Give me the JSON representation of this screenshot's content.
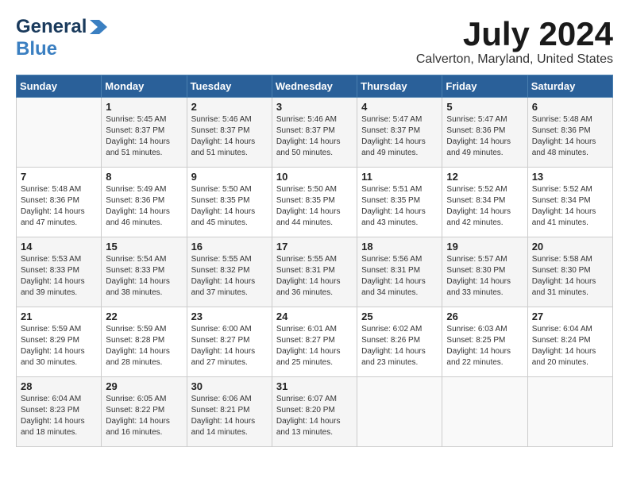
{
  "header": {
    "logo_line1": "General",
    "logo_line2": "Blue",
    "month": "July 2024",
    "location": "Calverton, Maryland, United States"
  },
  "days_of_week": [
    "Sunday",
    "Monday",
    "Tuesday",
    "Wednesday",
    "Thursday",
    "Friday",
    "Saturday"
  ],
  "weeks": [
    [
      {
        "day": "",
        "content": ""
      },
      {
        "day": "1",
        "content": "Sunrise: 5:45 AM\nSunset: 8:37 PM\nDaylight: 14 hours\nand 51 minutes."
      },
      {
        "day": "2",
        "content": "Sunrise: 5:46 AM\nSunset: 8:37 PM\nDaylight: 14 hours\nand 51 minutes."
      },
      {
        "day": "3",
        "content": "Sunrise: 5:46 AM\nSunset: 8:37 PM\nDaylight: 14 hours\nand 50 minutes."
      },
      {
        "day": "4",
        "content": "Sunrise: 5:47 AM\nSunset: 8:37 PM\nDaylight: 14 hours\nand 49 minutes."
      },
      {
        "day": "5",
        "content": "Sunrise: 5:47 AM\nSunset: 8:36 PM\nDaylight: 14 hours\nand 49 minutes."
      },
      {
        "day": "6",
        "content": "Sunrise: 5:48 AM\nSunset: 8:36 PM\nDaylight: 14 hours\nand 48 minutes."
      }
    ],
    [
      {
        "day": "7",
        "content": "Sunrise: 5:48 AM\nSunset: 8:36 PM\nDaylight: 14 hours\nand 47 minutes."
      },
      {
        "day": "8",
        "content": "Sunrise: 5:49 AM\nSunset: 8:36 PM\nDaylight: 14 hours\nand 46 minutes."
      },
      {
        "day": "9",
        "content": "Sunrise: 5:50 AM\nSunset: 8:35 PM\nDaylight: 14 hours\nand 45 minutes."
      },
      {
        "day": "10",
        "content": "Sunrise: 5:50 AM\nSunset: 8:35 PM\nDaylight: 14 hours\nand 44 minutes."
      },
      {
        "day": "11",
        "content": "Sunrise: 5:51 AM\nSunset: 8:35 PM\nDaylight: 14 hours\nand 43 minutes."
      },
      {
        "day": "12",
        "content": "Sunrise: 5:52 AM\nSunset: 8:34 PM\nDaylight: 14 hours\nand 42 minutes."
      },
      {
        "day": "13",
        "content": "Sunrise: 5:52 AM\nSunset: 8:34 PM\nDaylight: 14 hours\nand 41 minutes."
      }
    ],
    [
      {
        "day": "14",
        "content": "Sunrise: 5:53 AM\nSunset: 8:33 PM\nDaylight: 14 hours\nand 39 minutes."
      },
      {
        "day": "15",
        "content": "Sunrise: 5:54 AM\nSunset: 8:33 PM\nDaylight: 14 hours\nand 38 minutes."
      },
      {
        "day": "16",
        "content": "Sunrise: 5:55 AM\nSunset: 8:32 PM\nDaylight: 14 hours\nand 37 minutes."
      },
      {
        "day": "17",
        "content": "Sunrise: 5:55 AM\nSunset: 8:31 PM\nDaylight: 14 hours\nand 36 minutes."
      },
      {
        "day": "18",
        "content": "Sunrise: 5:56 AM\nSunset: 8:31 PM\nDaylight: 14 hours\nand 34 minutes."
      },
      {
        "day": "19",
        "content": "Sunrise: 5:57 AM\nSunset: 8:30 PM\nDaylight: 14 hours\nand 33 minutes."
      },
      {
        "day": "20",
        "content": "Sunrise: 5:58 AM\nSunset: 8:30 PM\nDaylight: 14 hours\nand 31 minutes."
      }
    ],
    [
      {
        "day": "21",
        "content": "Sunrise: 5:59 AM\nSunset: 8:29 PM\nDaylight: 14 hours\nand 30 minutes."
      },
      {
        "day": "22",
        "content": "Sunrise: 5:59 AM\nSunset: 8:28 PM\nDaylight: 14 hours\nand 28 minutes."
      },
      {
        "day": "23",
        "content": "Sunrise: 6:00 AM\nSunset: 8:27 PM\nDaylight: 14 hours\nand 27 minutes."
      },
      {
        "day": "24",
        "content": "Sunrise: 6:01 AM\nSunset: 8:27 PM\nDaylight: 14 hours\nand 25 minutes."
      },
      {
        "day": "25",
        "content": "Sunrise: 6:02 AM\nSunset: 8:26 PM\nDaylight: 14 hours\nand 23 minutes."
      },
      {
        "day": "26",
        "content": "Sunrise: 6:03 AM\nSunset: 8:25 PM\nDaylight: 14 hours\nand 22 minutes."
      },
      {
        "day": "27",
        "content": "Sunrise: 6:04 AM\nSunset: 8:24 PM\nDaylight: 14 hours\nand 20 minutes."
      }
    ],
    [
      {
        "day": "28",
        "content": "Sunrise: 6:04 AM\nSunset: 8:23 PM\nDaylight: 14 hours\nand 18 minutes."
      },
      {
        "day": "29",
        "content": "Sunrise: 6:05 AM\nSunset: 8:22 PM\nDaylight: 14 hours\nand 16 minutes."
      },
      {
        "day": "30",
        "content": "Sunrise: 6:06 AM\nSunset: 8:21 PM\nDaylight: 14 hours\nand 14 minutes."
      },
      {
        "day": "31",
        "content": "Sunrise: 6:07 AM\nSunset: 8:20 PM\nDaylight: 14 hours\nand 13 minutes."
      },
      {
        "day": "",
        "content": ""
      },
      {
        "day": "",
        "content": ""
      },
      {
        "day": "",
        "content": ""
      }
    ]
  ]
}
